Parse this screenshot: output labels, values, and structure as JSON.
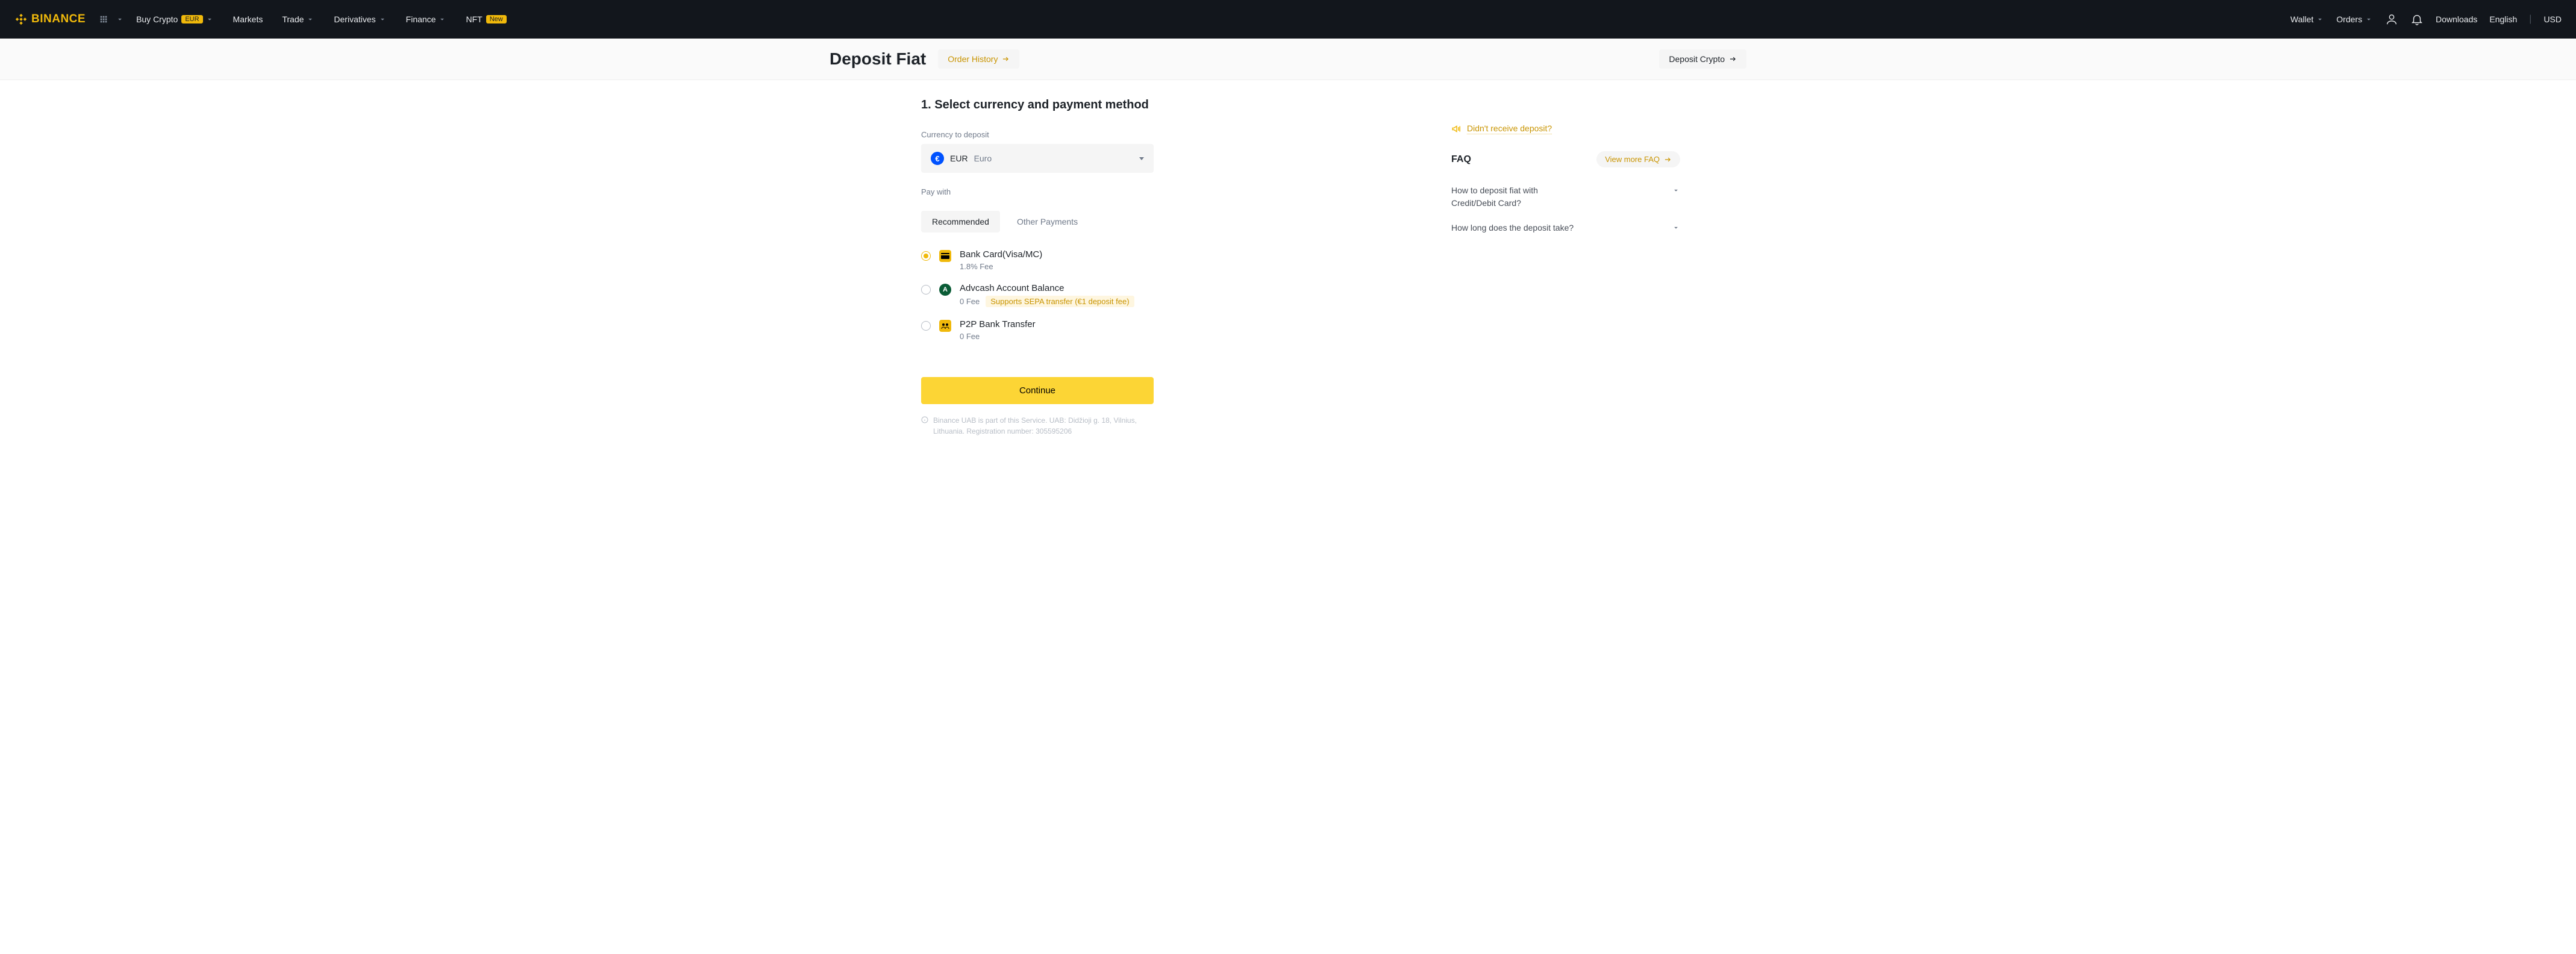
{
  "header": {
    "brand": "BINANCE",
    "nav": {
      "buy_crypto": "Buy Crypto",
      "buy_crypto_badge": "EUR",
      "markets": "Markets",
      "trade": "Trade",
      "derivatives": "Derivatives",
      "finance": "Finance",
      "nft": "NFT",
      "nft_badge": "New"
    },
    "right": {
      "wallet": "Wallet",
      "orders": "Orders",
      "downloads": "Downloads",
      "language": "English",
      "currency": "USD"
    }
  },
  "subheader": {
    "title": "Deposit Fiat",
    "order_history": "Order History",
    "deposit_crypto": "Deposit Crypto"
  },
  "main": {
    "step_title": "1. Select currency and payment method",
    "currency_label": "Currency to deposit",
    "currency_code": "EUR",
    "currency_name": "Euro",
    "currency_symbol": "€",
    "pay_with_label": "Pay with",
    "tabs": {
      "recommended": "Recommended",
      "other": "Other Payments"
    },
    "payment_methods": [
      {
        "id": "card",
        "name": "Bank Card(Visa/MC)",
        "fee": "1.8% Fee",
        "selected": true
      },
      {
        "id": "advcash",
        "name": "Advcash Account Balance",
        "fee": "0 Fee",
        "tag": "Supports SEPA transfer (€1 deposit fee)",
        "selected": false
      },
      {
        "id": "p2p",
        "name": "P2P Bank Transfer",
        "fee": "0 Fee",
        "selected": false
      }
    ],
    "continue": "Continue",
    "disclaimer": "Binance UAB is part of this Service. UAB: Didžioji g. 18, Vilnius, Lithuania. Registration number: 305595206"
  },
  "side": {
    "notice": "Didn't receive deposit?",
    "faq_title": "FAQ",
    "faq_more": "View more FAQ",
    "faq_items": [
      "How to deposit fiat with Credit/Debit Card?",
      "How long does the deposit take?"
    ]
  }
}
